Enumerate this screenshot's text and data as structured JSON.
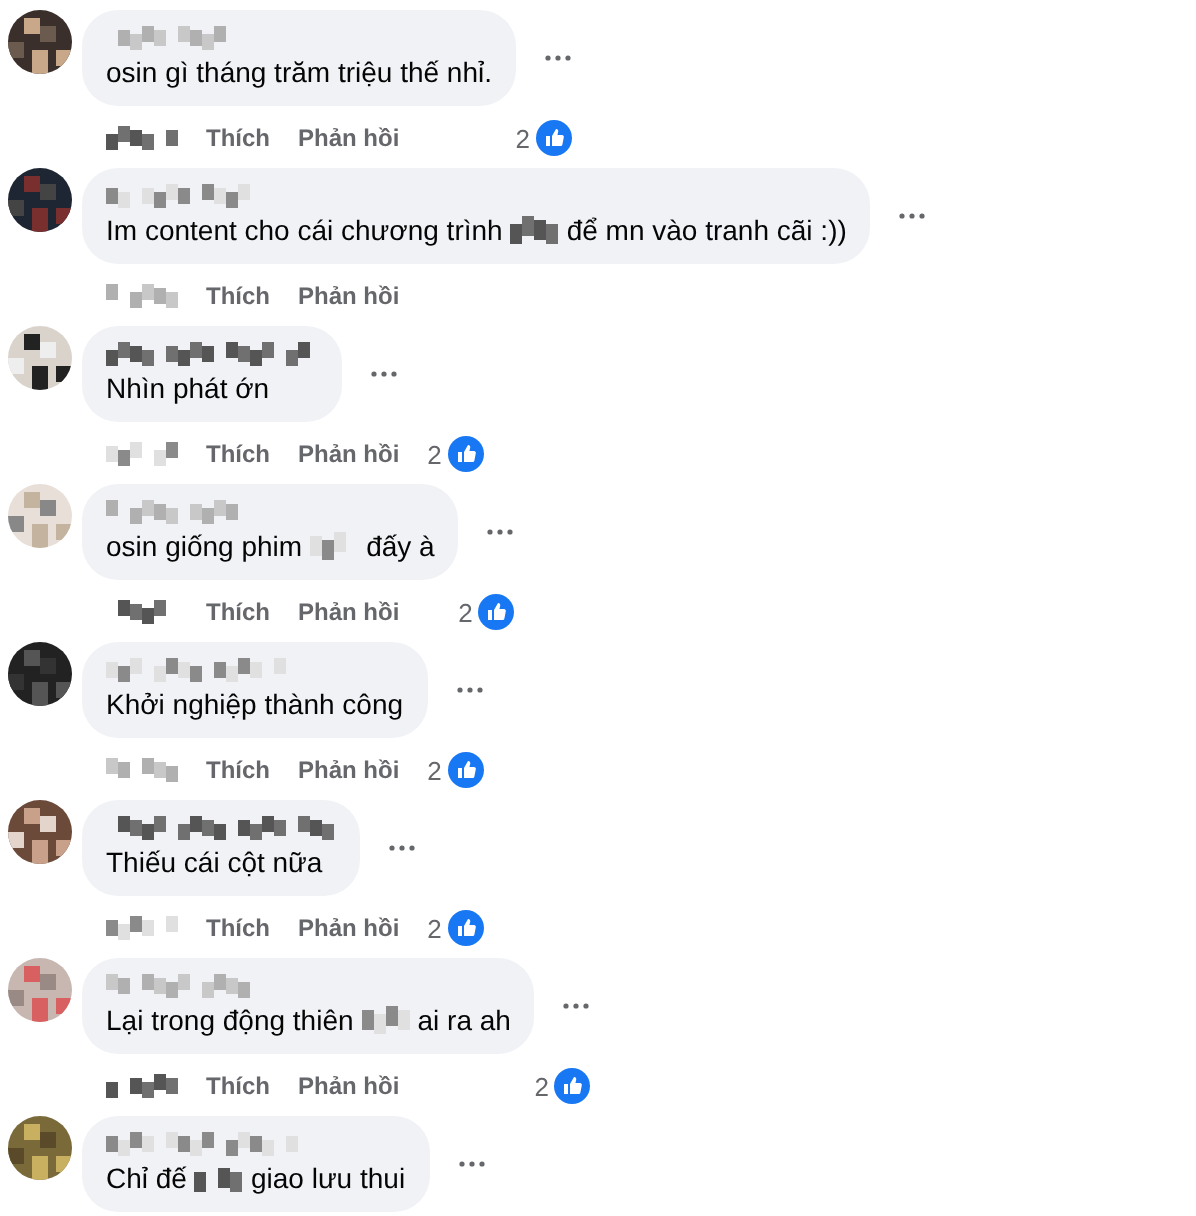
{
  "comments": [
    {
      "parts": [
        {
          "kind": "text",
          "text": "osin gì tháng trăm triệu thế nhỉ."
        }
      ],
      "actions": [
        "Thích",
        "Phản hồi"
      ],
      "reactions": "2"
    },
    {
      "parts": [
        {
          "kind": "text",
          "text": "Im content cho cái chương trình"
        },
        {
          "kind": "blur"
        },
        {
          "kind": "text",
          "text": "để mn vào tranh cãi :))"
        }
      ],
      "actions": [
        "Thích",
        "Phản hồi"
      ]
    },
    {
      "parts": [
        {
          "kind": "text",
          "text": "Nhìn phát ớn"
        }
      ],
      "actions": [
        "Thích",
        "Phản hồi"
      ],
      "reactions": "2"
    },
    {
      "parts": [
        {
          "kind": "text",
          "text": "osin giống phim"
        },
        {
          "kind": "blur"
        },
        {
          "kind": "text",
          "text": "đấy à"
        }
      ],
      "actions": [
        "Thích",
        "Phản hồi"
      ],
      "reactions": "2"
    },
    {
      "parts": [
        {
          "kind": "text",
          "text": "Khởi nghiệp thành công"
        }
      ],
      "actions": [
        "Thích",
        "Phản hồi"
      ],
      "reactions": "2"
    },
    {
      "parts": [
        {
          "kind": "text",
          "text": "Thiếu cái cột nữa"
        }
      ],
      "actions": [
        "Thích",
        "Phản hồi"
      ],
      "reactions": "2"
    },
    {
      "parts": [
        {
          "kind": "text",
          "text": "Lại trong động thiên"
        },
        {
          "kind": "blur"
        },
        {
          "kind": "text",
          "text": "ai ra ah"
        }
      ],
      "actions": [
        "Thích",
        "Phản hồi"
      ],
      "reactions": "2"
    },
    {
      "parts": [
        {
          "kind": "text",
          "text": "Chỉ đế"
        },
        {
          "kind": "blur"
        },
        {
          "kind": "text",
          "text": "giao lưu thui"
        }
      ]
    }
  ]
}
